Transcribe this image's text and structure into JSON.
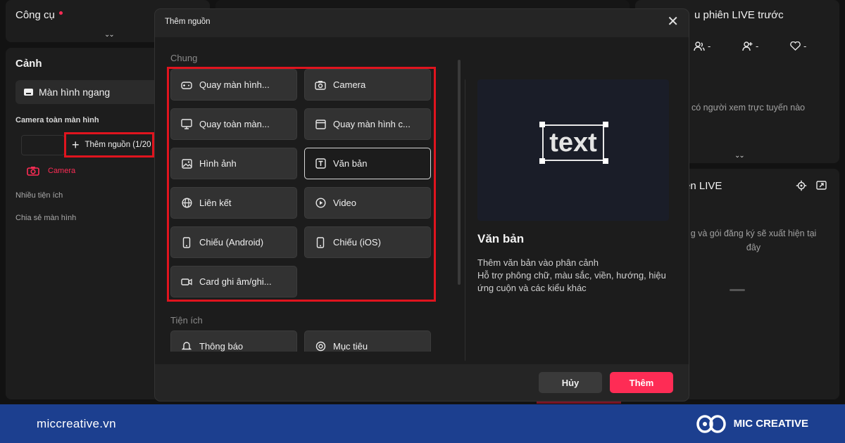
{
  "app": {
    "tools_title": "Công cụ",
    "scenes_title": "Cảnh",
    "scene_item": "Màn hình ngang",
    "scene_section": "Camera toàn màn hình",
    "add_source_label": "Thêm nguồn (1/20",
    "camera_label": "Camera",
    "utilities_label": "Nhiều tiện ích",
    "screen_share_label": "Chia sẻ màn hình",
    "stats_title": "u phiên LIVE trước",
    "stats": [
      "-",
      "-",
      "-"
    ],
    "stats_message": "có người xem trực tuyến nào",
    "live_title": "ện LIVE",
    "live_message": "g và gói đăng ký sẽ xuất hiện tại đây"
  },
  "modal": {
    "title": "Thêm nguồn",
    "close_label": "✕",
    "group_general": "Chung",
    "group_utilities": "Tiện ích",
    "sources": [
      {
        "label": "Quay màn hình...",
        "icon": "gamepad-icon"
      },
      {
        "label": "Camera",
        "icon": "camera-icon"
      },
      {
        "label": "Quay toàn màn...",
        "icon": "monitor-icon"
      },
      {
        "label": "Quay màn hình c...",
        "icon": "window-icon"
      },
      {
        "label": "Hình ảnh",
        "icon": "image-icon"
      },
      {
        "label": "Văn bản",
        "icon": "text-icon",
        "selected": true
      },
      {
        "label": "Liên kết",
        "icon": "globe-icon"
      },
      {
        "label": "Video",
        "icon": "play-icon"
      },
      {
        "label": "Chiếu (Android)",
        "icon": "phone-icon"
      },
      {
        "label": "Chiếu (iOS)",
        "icon": "phone-icon"
      },
      {
        "label": "Card ghi âm/ghi...",
        "icon": "video-camera-icon"
      }
    ],
    "utilities": [
      {
        "label": "Thông báo",
        "icon": "bell-icon"
      },
      {
        "label": "Mục tiêu",
        "icon": "target-icon"
      }
    ],
    "preview_text": "text",
    "detail_title": "Văn bản",
    "detail_line1": "Thêm văn bản vào phân cảnh",
    "detail_line2": "Hỗ trợ phông chữ, màu sắc, viền, hướng, hiệu ứng cuộn và các kiểu khác",
    "cancel_label": "Hủy",
    "add_label": "Thêm"
  },
  "footer": {
    "site": "miccreative.vn",
    "brand": "MIC CREATIVE"
  },
  "colors": {
    "accent": "#fe2c55",
    "highlight": "#e0141e",
    "footer_bg": "#1c3f8f"
  }
}
